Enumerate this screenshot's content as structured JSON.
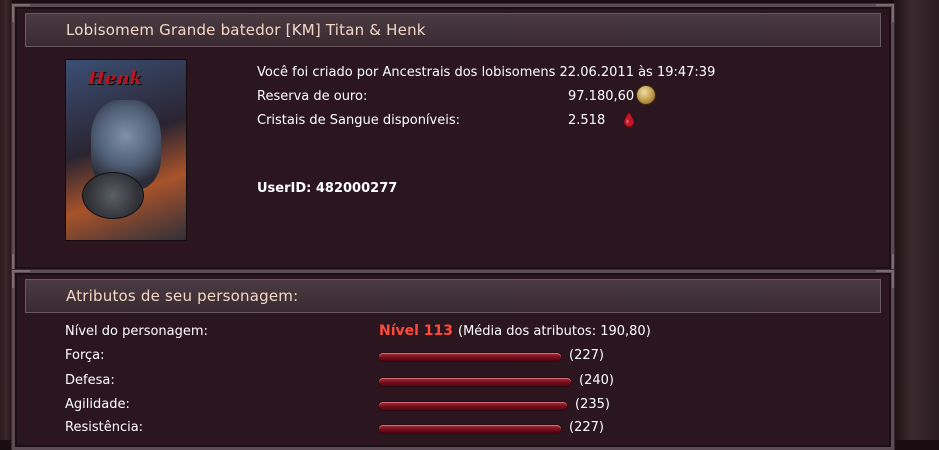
{
  "profile_panel": {
    "title": "Lobisomem Grande batedor [KM] Titan & Henk",
    "avatar_name": "Henk",
    "created_text": "Você foi criado por Ancestrais dos lobisomens 22.06.2011 às 19:47:39",
    "gold_label": "Reserva de ouro:",
    "gold_value": "97.180,60",
    "gold_icon": "gold-coins-icon",
    "crystals_label": "Cristais de Sangue disponíveis:",
    "crystals_value": "2.518",
    "crystals_icon": "blood-drop-icon",
    "user_id": "UserID: 482000277"
  },
  "attributes_panel": {
    "title": "Atributos de seu personagem:",
    "level_label": "Nível do personagem:",
    "level_value": "Nível 113",
    "average_text": "(Média dos atributos: 190,80)",
    "attributes": [
      {
        "label": "Força:",
        "value": "(227)",
        "amount": 227
      },
      {
        "label": "Defesa:",
        "value": "(240)",
        "amount": 240
      },
      {
        "label": "Agilidade:",
        "value": "(235)",
        "amount": 235
      },
      {
        "label": "Resistência:",
        "value": "(227)",
        "amount": 227
      }
    ]
  },
  "colors": {
    "panel_bg": "#2b1620",
    "header_text": "#f3d7c7",
    "level_accent": "#ff4a3a",
    "bar_red": "#7b0f1e"
  }
}
